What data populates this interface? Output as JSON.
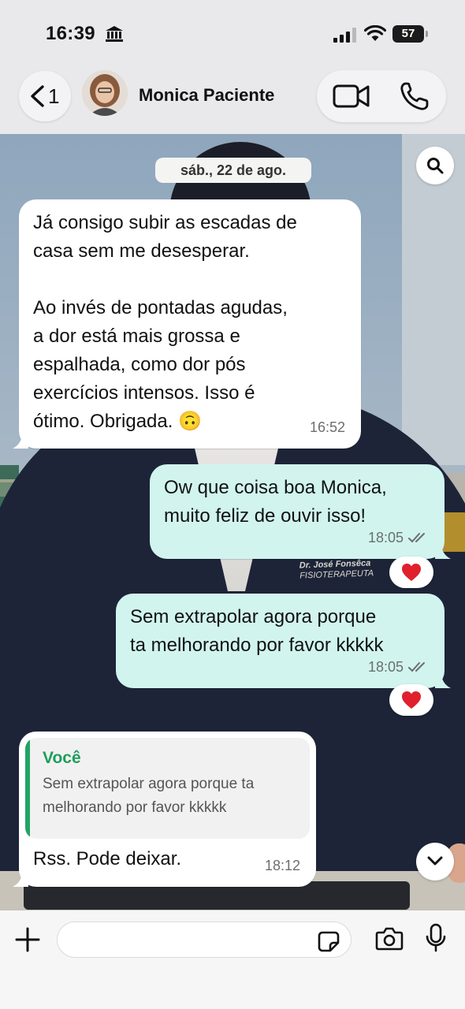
{
  "status_bar": {
    "time": "16:39",
    "battery_level": "57",
    "battery_percent": 57,
    "icons": [
      "bank-icon",
      "signal-icon",
      "wifi-icon",
      "battery-icon"
    ]
  },
  "header": {
    "back_count": "1",
    "contact_name": "Monica Paciente",
    "icons": [
      "chevron-left-icon",
      "video-camera-icon",
      "phone-icon"
    ]
  },
  "chat": {
    "date_chip": "sáb., 22 de ago.",
    "messages": [
      {
        "direction": "incoming",
        "text": "Já consigo subir as escadas de\ncasa sem me desesperar.\n\nAo invés de pontadas agudas,\na dor está mais grossa e\nespalhada, como dor pós\nexercícios intensos. Isso é\nótimo. Obrigada. 🙃",
        "time": "16:52"
      },
      {
        "direction": "outgoing",
        "text": "Ow que coisa boa Monica,\nmuito feliz de ouvir isso!",
        "time": "18:05",
        "read": true,
        "reaction": "heart"
      },
      {
        "direction": "outgoing",
        "text": "Sem extrapolar agora porque\nta melhorando por favor kkkkk",
        "time": "18:05",
        "read": true,
        "reaction": "heart"
      },
      {
        "direction": "incoming",
        "quote": {
          "author": "Você",
          "text": "Sem extrapolar agora porque ta\nmelhorando por favor kkkkk"
        },
        "text": "Rss. Pode deixar.",
        "time": "18:12"
      }
    ],
    "wallpaper_embroidery": [
      "Dr. José Fonsêca",
      "FISIOTERAPEUTA"
    ]
  },
  "composer": {
    "placeholder": "",
    "icons": [
      "plus-icon",
      "sticker-icon",
      "camera-icon",
      "microphone-icon"
    ]
  },
  "colors": {
    "outgoing_bubble": "#d1f4ef",
    "incoming_bubble": "#ffffff",
    "quote_accent": "#21a366",
    "reaction_heart": "#e0202c"
  }
}
